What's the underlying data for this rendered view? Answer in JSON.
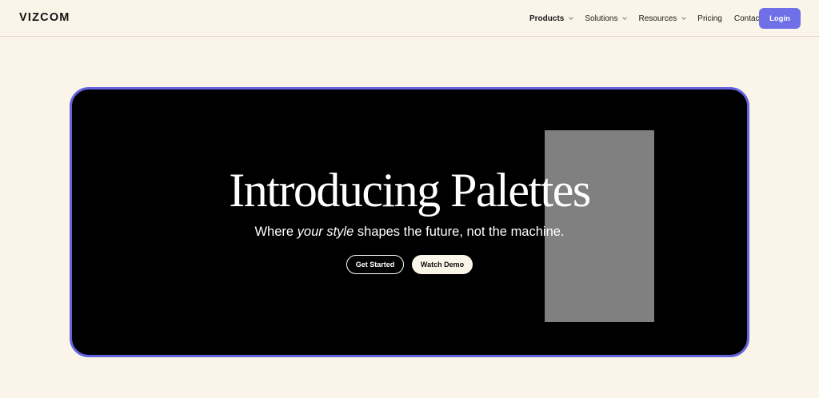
{
  "header": {
    "logo": "VIZCOM",
    "nav": [
      {
        "label": "Products",
        "has_dropdown": true,
        "active": true
      },
      {
        "label": "Solutions",
        "has_dropdown": true,
        "active": false
      },
      {
        "label": "Resources",
        "has_dropdown": true,
        "active": false
      },
      {
        "label": "Pricing",
        "has_dropdown": false,
        "active": false
      },
      {
        "label": "Contact",
        "has_dropdown": false,
        "active": false
      }
    ],
    "login_label": "Login",
    "icons": {
      "dropdown": "chevron-down-icon"
    }
  },
  "hero": {
    "title": "Introducing Palettes",
    "subtitle_pre": "Where ",
    "subtitle_em": "your style",
    "subtitle_post": " shapes the future, not the machine.",
    "get_started_label": "Get Started",
    "watch_demo_label": "Watch Demo"
  },
  "colors": {
    "background": "#fbf4e8",
    "accent": "#6f6fe8",
    "hero_border": "#6363e0",
    "hero_bg": "#000000",
    "media_placeholder": "#808080"
  }
}
